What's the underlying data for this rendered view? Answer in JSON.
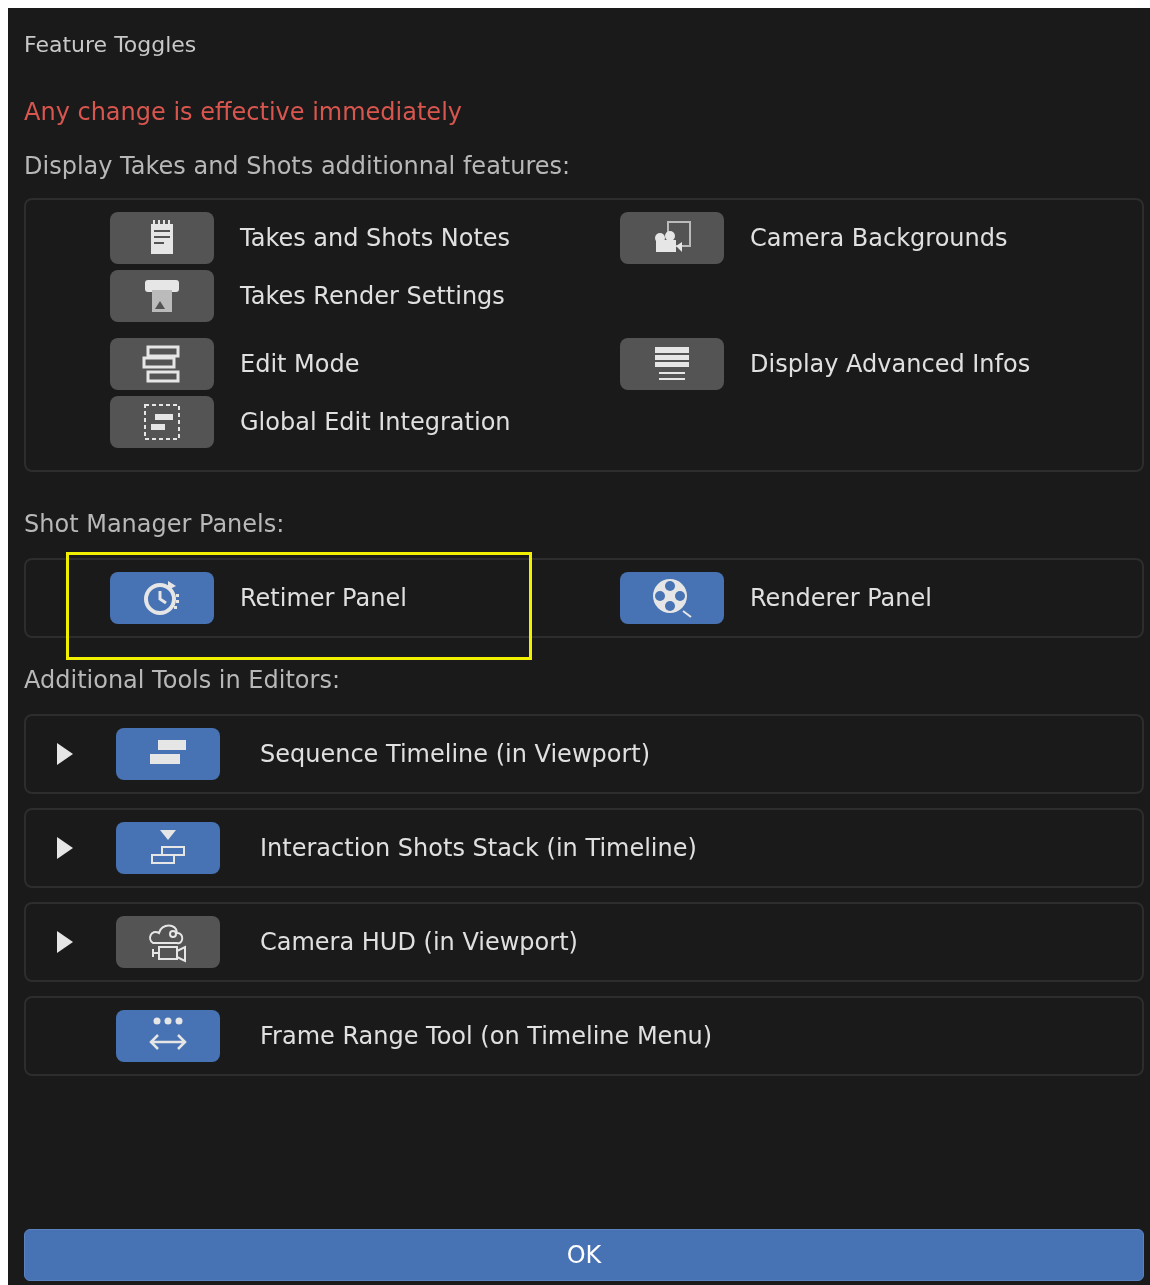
{
  "title": "Feature Toggles",
  "warning": "Any change is effective immediately",
  "display_section": {
    "heading": "Display Takes and Shots additionnal features:",
    "groups": [
      {
        "left": [
          {
            "label": "Takes and Shots Notes",
            "on": false
          },
          {
            "label": "Takes Render Settings",
            "on": false
          }
        ],
        "right": [
          {
            "label": "Camera Backgrounds",
            "on": false
          }
        ]
      },
      {
        "left": [
          {
            "label": "Edit Mode",
            "on": false
          },
          {
            "label": "Global Edit Integration",
            "on": false
          }
        ],
        "right": [
          {
            "label": "Display Advanced Infos",
            "on": false
          }
        ]
      }
    ]
  },
  "panels_section": {
    "heading": "Shot Manager Panels:",
    "items": [
      {
        "label": "Retimer Panel",
        "on": true,
        "highlighted": true
      },
      {
        "label": "Renderer Panel",
        "on": true,
        "highlighted": false
      }
    ]
  },
  "tools_section": {
    "heading": "Additional Tools in Editors:",
    "items": [
      {
        "kind": "expandable",
        "label": "Sequence Timeline (in Viewport)",
        "on": true,
        "expanded": false
      },
      {
        "kind": "expandable",
        "label": "Interaction Shots Stack (in Timeline)",
        "on": true,
        "expanded": false
      },
      {
        "kind": "expandable",
        "label": "Camera HUD (in Viewport)",
        "on": false,
        "expanded": false
      },
      {
        "kind": "plain",
        "label": "Frame Range Tool (on Timeline Menu)",
        "on": true
      }
    ]
  },
  "ok_button": "OK"
}
